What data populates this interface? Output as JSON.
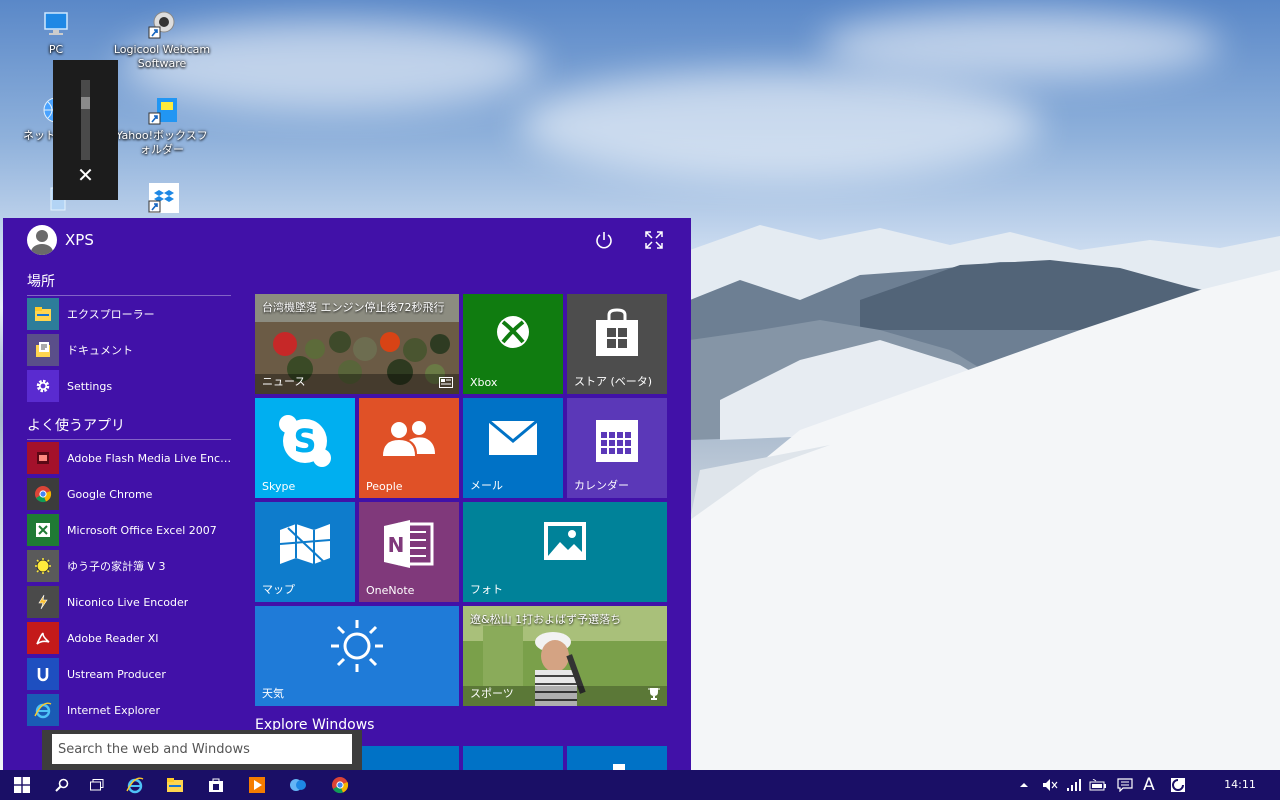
{
  "desktop": {
    "icons": [
      {
        "label": "PC"
      },
      {
        "label": "Logicool Webcam Software"
      },
      {
        "label": "ネットワーク"
      },
      {
        "label": "Yahoo!ボックスフォルダー"
      }
    ]
  },
  "volume_flyout": {
    "close_glyph": "✕",
    "level_fraction": 0.75
  },
  "start_menu": {
    "user_name": "XPS",
    "places_header": "場所",
    "places": [
      {
        "label": "エクスプローラー",
        "icon": "folder-icon"
      },
      {
        "label": "ドキュメント",
        "icon": "documents-icon"
      },
      {
        "label": "Settings",
        "icon": "gear-icon"
      }
    ],
    "frequent_header": "よく使うアプリ",
    "frequent_apps": [
      {
        "label": "Adobe Flash Media Live Encod…",
        "icon": "flash-media-icon"
      },
      {
        "label": "Google Chrome",
        "icon": "chrome-icon"
      },
      {
        "label": "Microsoft Office Excel 2007",
        "icon": "excel-icon"
      },
      {
        "label": "ゆう子の家計簿 V 3",
        "icon": "kakeibo-icon"
      },
      {
        "label": "Niconico Live Encoder",
        "icon": "niconico-icon"
      },
      {
        "label": "Adobe Reader XI",
        "icon": "adobe-reader-icon"
      },
      {
        "label": "Ustream Producer",
        "icon": "ustream-icon"
      },
      {
        "label": "Internet Explorer",
        "icon": "ie-icon"
      }
    ],
    "tiles": {
      "news": {
        "label": "ニュース",
        "headline": "台湾機墜落 エンジン停止後72秒飛行"
      },
      "xbox": {
        "label": "Xbox"
      },
      "store": {
        "label": "ストア (ベータ)"
      },
      "skype": {
        "label": "Skype"
      },
      "people": {
        "label": "People"
      },
      "mail": {
        "label": "メール"
      },
      "calendar": {
        "label": "カレンダー"
      },
      "maps": {
        "label": "マップ"
      },
      "onenote": {
        "label": "OneNote"
      },
      "photos": {
        "label": "フォト"
      },
      "weather": {
        "label": "天気"
      },
      "sports": {
        "label": "スポーツ",
        "headline": "遼&松山 1打およばず予選落ち"
      }
    },
    "explore_header": "Explore Windows",
    "search_placeholder": "Search the web and Windows"
  },
  "taskbar": {
    "clock": "14:11",
    "ime_indicator": "A",
    "colors": {
      "taskbar": "#1a0f66",
      "start_menu": "#4111a8"
    }
  }
}
